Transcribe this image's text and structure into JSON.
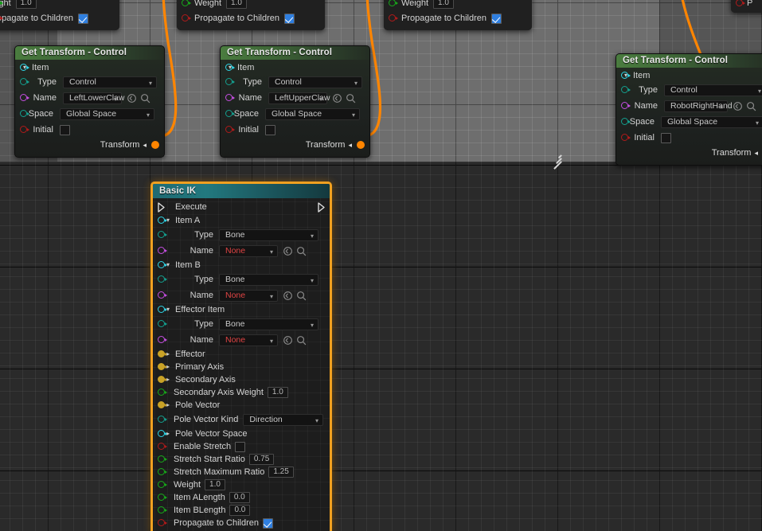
{
  "graph": {
    "wire_color": "#ff8500",
    "selection_color": "#f0a020"
  },
  "partial_nodes": [
    {
      "id": "partial-left",
      "rows": [
        {
          "label": "ight",
          "value": "1.0",
          "kind": "number"
        },
        {
          "label": "opagate to Children",
          "value": "checked",
          "kind": "checkbox"
        }
      ]
    },
    {
      "id": "partial-mid1",
      "rows": [
        {
          "label": "Weight",
          "value": "1.0",
          "kind": "number"
        },
        {
          "label": "Propagate to Children",
          "value": "checked",
          "kind": "checkbox"
        }
      ]
    },
    {
      "id": "partial-mid2",
      "rows": [
        {
          "label": "Weight",
          "value": "1.0",
          "kind": "number"
        },
        {
          "label": "Propagate to Children",
          "value": "checked",
          "kind": "checkbox"
        }
      ]
    },
    {
      "id": "partial-right",
      "rows": [
        {
          "label": "P",
          "value": "",
          "kind": "text"
        }
      ]
    }
  ],
  "get_transform_nodes": [
    {
      "id": "get-transform-left",
      "title": "Get Transform - Control",
      "item_label": "Item",
      "type_label": "Type",
      "type_value": "Control",
      "name_label": "Name",
      "name_value": "LeftLowerClaw",
      "space_label": "Space",
      "space_value": "Global Space",
      "initial_label": "Initial",
      "initial_checked": false,
      "output_label": "Transform"
    },
    {
      "id": "get-transform-mid",
      "title": "Get Transform - Control",
      "item_label": "Item",
      "type_label": "Type",
      "type_value": "Control",
      "name_label": "Name",
      "name_value": "LeftUpperClaw",
      "space_label": "Space",
      "space_value": "Global Space",
      "initial_label": "Initial",
      "initial_checked": false,
      "output_label": "Transform"
    },
    {
      "id": "get-transform-right",
      "title": "Get Transform - Control",
      "item_label": "Item",
      "type_label": "Type",
      "type_value": "Control",
      "name_label": "Name",
      "name_value": "RobotRightHand",
      "space_label": "Space",
      "space_value": "Global Space",
      "initial_label": "Initial",
      "initial_checked": false,
      "output_label": "Transform"
    }
  ],
  "basic_ik": {
    "title": "Basic IK",
    "selected": true,
    "exec_label": "Execute",
    "groups": [
      {
        "header": "Item A",
        "type_label": "Type",
        "type_value": "Bone",
        "name_label": "Name",
        "name_value": "None"
      },
      {
        "header": "Item B",
        "type_label": "Type",
        "type_value": "Bone",
        "name_label": "Name",
        "name_value": "None"
      },
      {
        "header": "Effector Item",
        "type_label": "Type",
        "type_value": "Bone",
        "name_label": "Name",
        "name_value": "None"
      }
    ],
    "properties": [
      {
        "label": "Effector",
        "kind": "expander",
        "pin": "olive"
      },
      {
        "label": "Primary Axis",
        "kind": "expander",
        "pin": "olive"
      },
      {
        "label": "Secondary Axis",
        "kind": "expander",
        "pin": "olive"
      },
      {
        "label": "Secondary Axis Weight",
        "kind": "number",
        "value": "1.0",
        "pin": "green"
      },
      {
        "label": "Pole Vector",
        "kind": "expander",
        "pin": "olive"
      },
      {
        "label": "Pole Vector Kind",
        "kind": "combo",
        "value": "Direction",
        "pin": "teal"
      },
      {
        "label": "Pole Vector Space",
        "kind": "expander",
        "pin": "cyan"
      },
      {
        "label": "Enable Stretch",
        "kind": "checkbox",
        "value": "unchecked",
        "pin": "red"
      },
      {
        "label": "Stretch Start Ratio",
        "kind": "number",
        "value": "0.75",
        "pin": "green"
      },
      {
        "label": "Stretch Maximum Ratio",
        "kind": "number",
        "value": "1.25",
        "pin": "green"
      },
      {
        "label": "Weight",
        "kind": "number",
        "value": "1.0",
        "pin": "green"
      },
      {
        "label": "Item ALength",
        "kind": "number",
        "value": "0.0",
        "pin": "green"
      },
      {
        "label": "Item BLength",
        "kind": "number",
        "value": "0.0",
        "pin": "green"
      },
      {
        "label": "Propagate to Children",
        "kind": "checkbox",
        "value": "checked",
        "pin": "red"
      }
    ]
  },
  "icons": {
    "reset": "reset-icon",
    "browse": "search-icon",
    "dropdown": "chevron-down-icon",
    "expander_closed": "triangle-right-icon",
    "expander_open": "triangle-down-icon",
    "resize": "resize-grip-icon"
  }
}
